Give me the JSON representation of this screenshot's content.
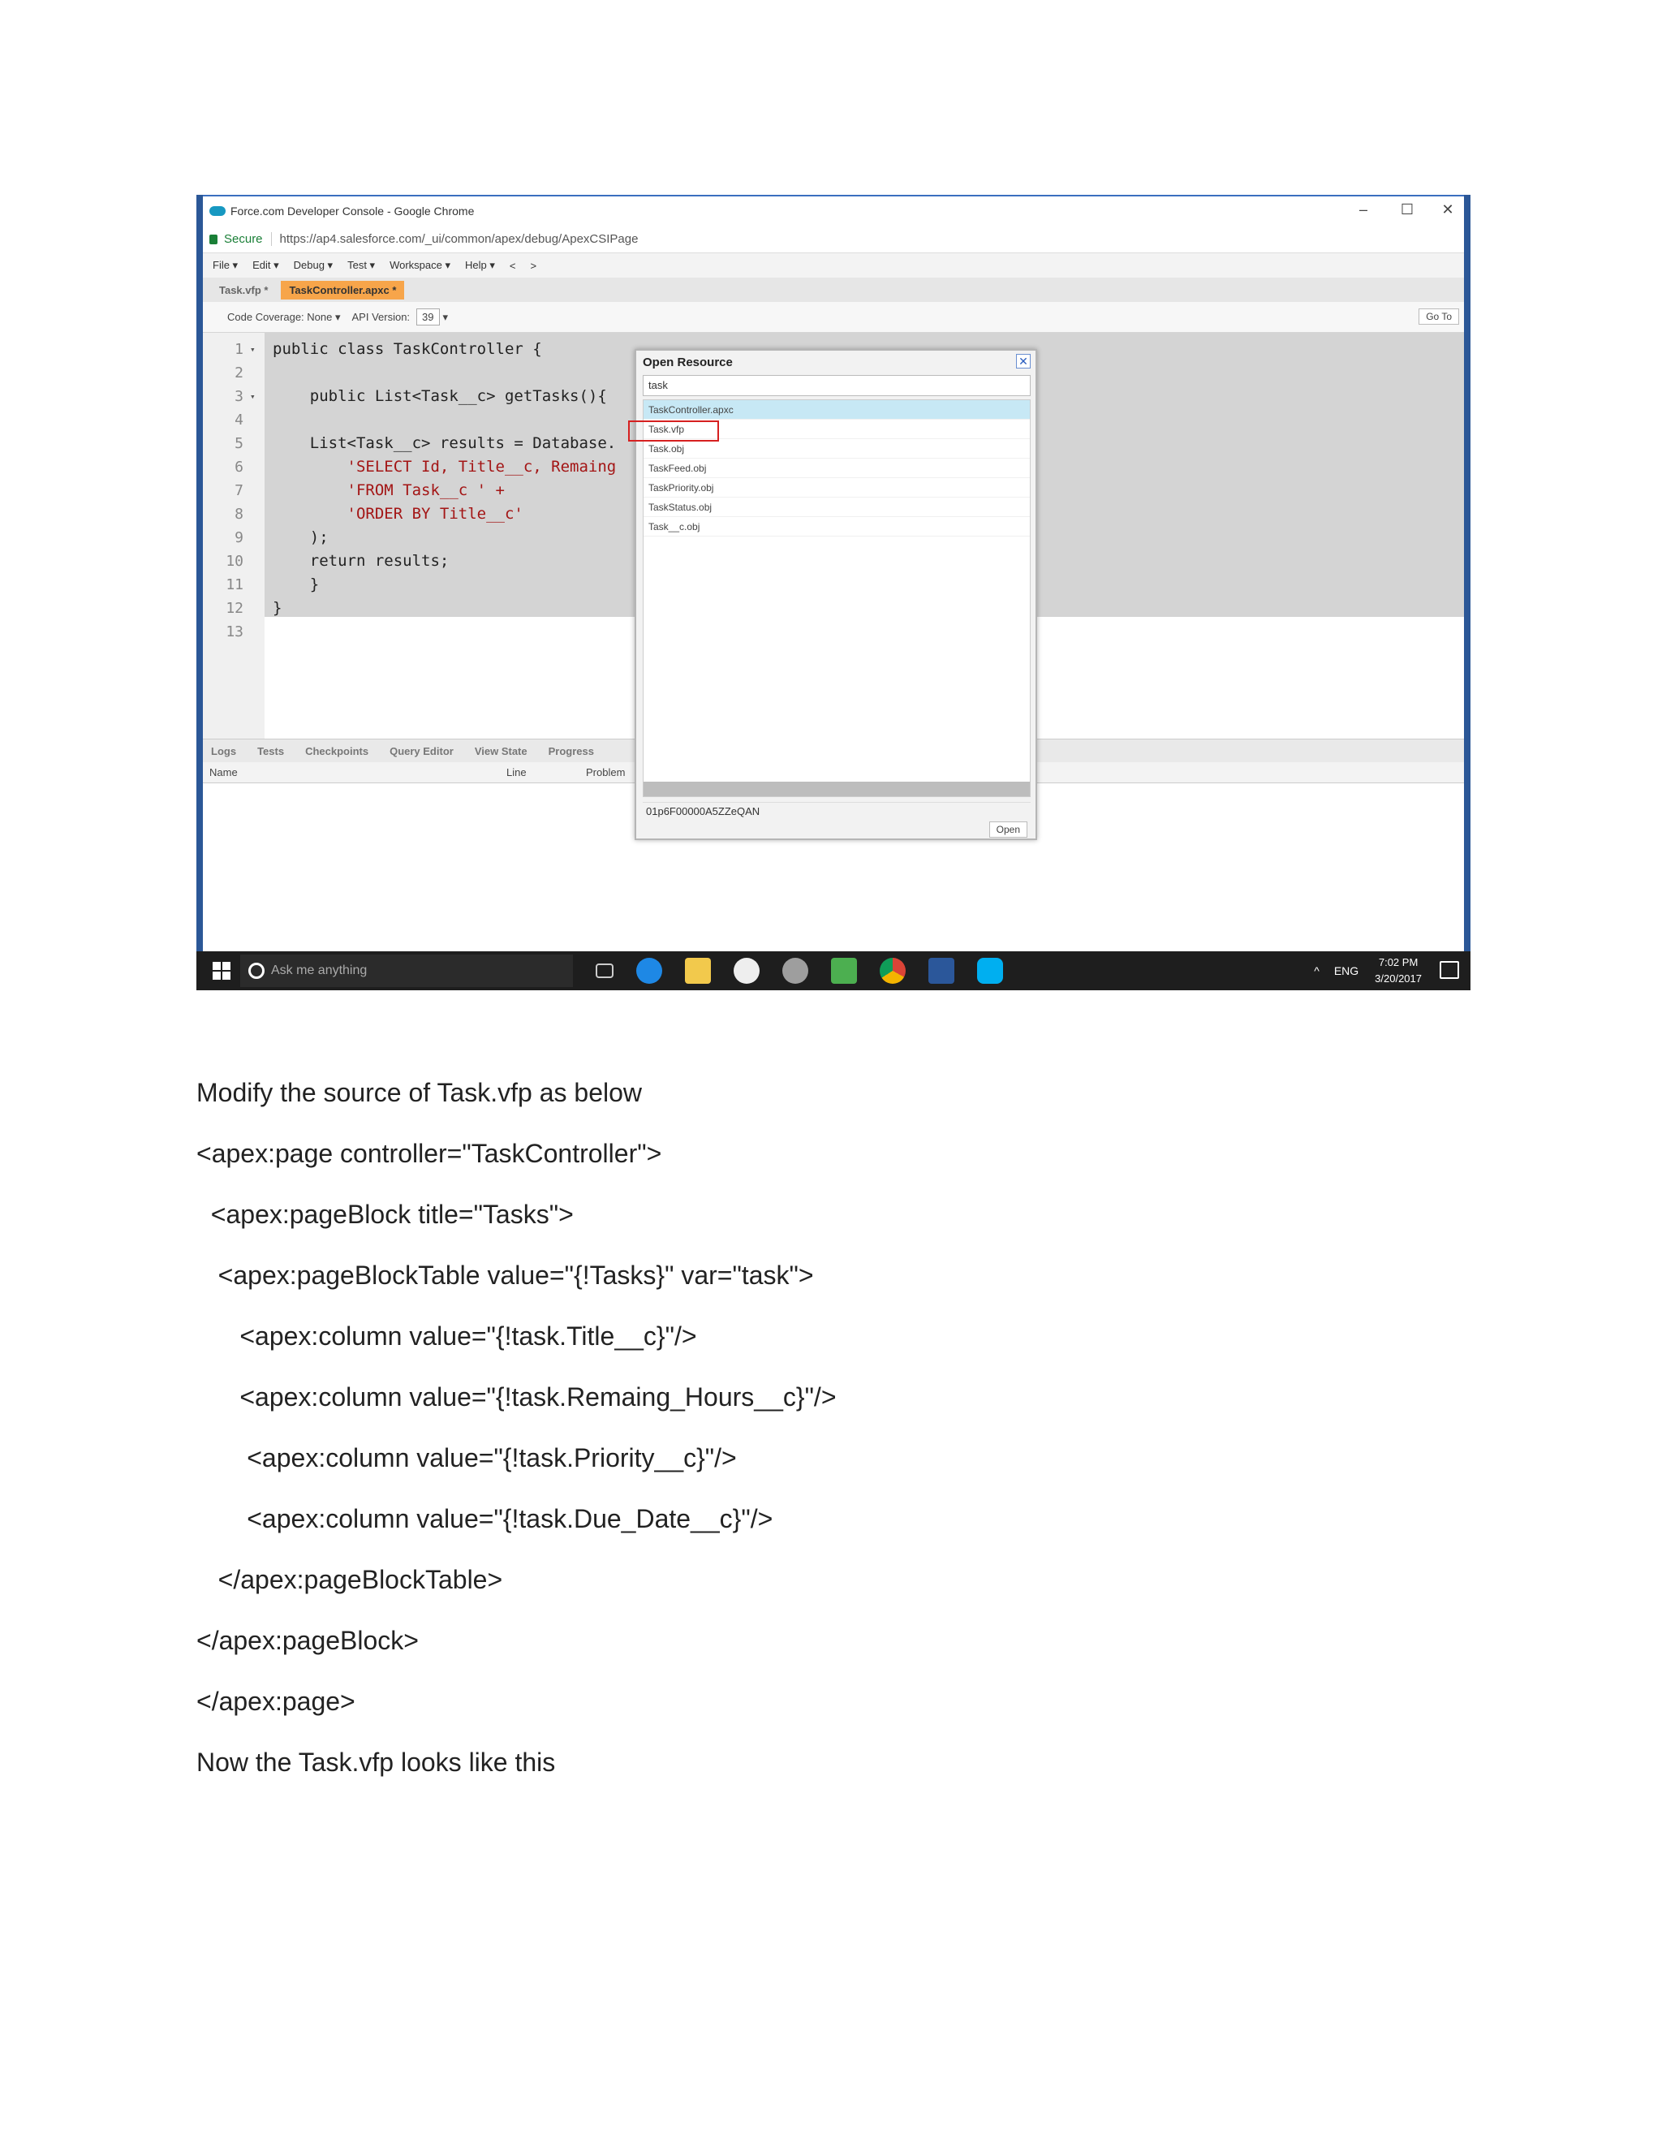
{
  "screenshot": {
    "window_title": "Force.com Developer Console - Google Chrome",
    "secure_label": "Secure",
    "url": "https://ap4.salesforce.com/_ui/common/apex/debug/ApexCSIPage",
    "menus": [
      "File ▾",
      "Edit ▾",
      "Debug ▾",
      "Test ▾",
      "Workspace ▾",
      "Help ▾",
      "<",
      ">"
    ],
    "tabs": [
      "Task.vfp *",
      "TaskController.apxc *"
    ],
    "coverage_label": "Code Coverage: None ▾",
    "api_label": "API Version:",
    "api_version": "39",
    "goto_label": "Go To",
    "code_lines": [
      {
        "n": "1",
        "fold": "▾",
        "text": "public class TaskController {"
      },
      {
        "n": "2",
        "fold": "",
        "text": ""
      },
      {
        "n": "3",
        "fold": "▾",
        "text": "    public List<Task__c> getTasks(){"
      },
      {
        "n": "4",
        "fold": "",
        "text": ""
      },
      {
        "n": "5",
        "fold": "",
        "text": "    List<Task__c> results = Database."
      },
      {
        "n": "6",
        "fold": "",
        "text": "        'SELECT Id, Title__c, Remaing"
      },
      {
        "n": "7",
        "fold": "",
        "text": "        'FROM Task__c ' +"
      },
      {
        "n": "8",
        "fold": "",
        "text": "        'ORDER BY Title__c'"
      },
      {
        "n": "9",
        "fold": "",
        "text": "    );"
      },
      {
        "n": "10",
        "fold": "",
        "text": "    return results;"
      },
      {
        "n": "11",
        "fold": "",
        "text": "    }"
      },
      {
        "n": "12",
        "fold": "",
        "text": "}"
      },
      {
        "n": "13",
        "fold": "",
        "text": ""
      }
    ],
    "bottom_tabs": [
      "Logs",
      "Tests",
      "Checkpoints",
      "Query Editor",
      "View State",
      "Progress"
    ],
    "bottom_columns": [
      "Name",
      "Line",
      "Problem"
    ],
    "dialog": {
      "title": "Open Resource",
      "close": "✕",
      "search_value": "task",
      "items": [
        "TaskController.apxc",
        "Task.vfp",
        "Task.obj",
        "TaskFeed.obj",
        "TaskPriority.obj",
        "TaskStatus.obj",
        "Task__c.obj"
      ],
      "selected_id": "01p6F00000A5ZZeQAN",
      "open_label": "Open"
    },
    "taskbar": {
      "search_placeholder": "Ask me anything",
      "tray_lang": "ENG",
      "time": "7:02 PM",
      "date": "3/20/2017"
    }
  },
  "document": {
    "lines": [
      "Modify the source of Task.vfp as below",
      "<apex:page controller=\"TaskController\">",
      "  <apex:pageBlock title=\"Tasks\">",
      "   <apex:pageBlockTable value=\"{!Tasks}\" var=\"task\">",
      "      <apex:column value=\"{!task.Title__c}\"/>",
      "      <apex:column value=\"{!task.Remaing_Hours__c}\"/>",
      "       <apex:column value=\"{!task.Priority__c}\"/>",
      "       <apex:column value=\"{!task.Due_Date__c}\"/>",
      "   </apex:pageBlockTable>",
      "</apex:pageBlock>",
      "</apex:page>",
      "Now the Task.vfp looks like this"
    ]
  }
}
